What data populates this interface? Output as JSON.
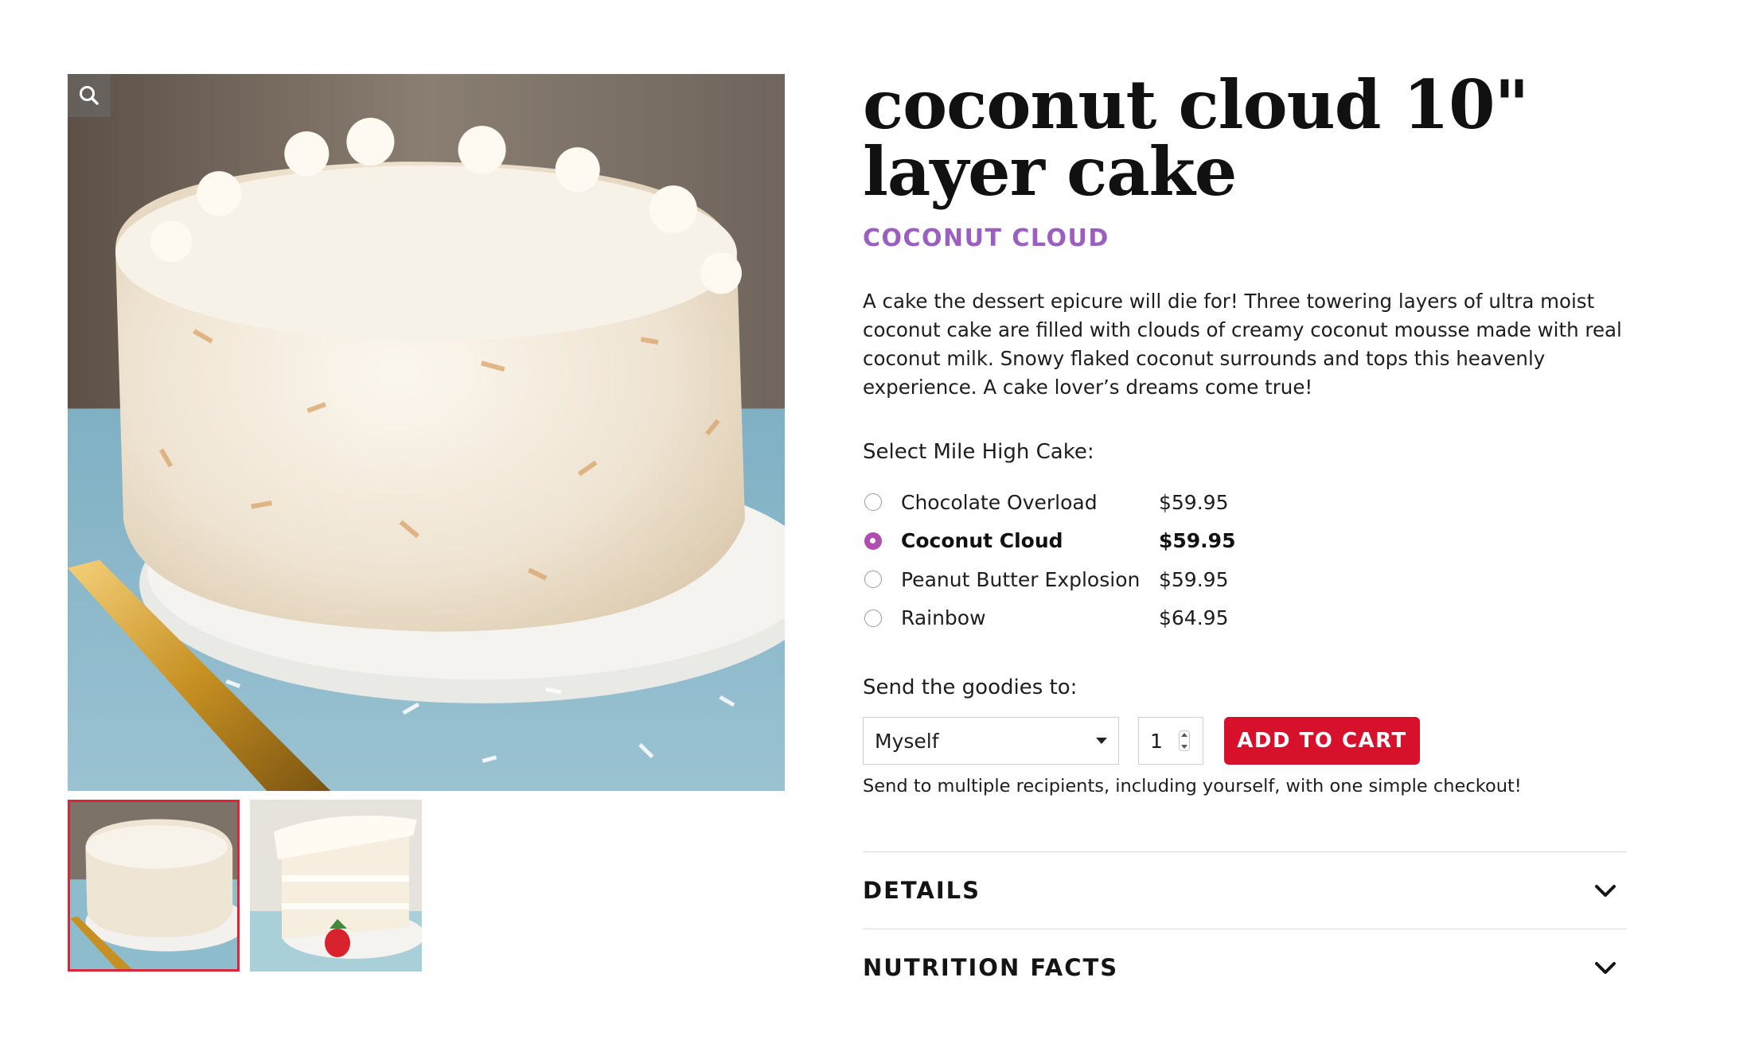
{
  "gallery": {
    "zoom_icon": "search-icon",
    "selected_thumbnail": 1,
    "thumbnail_count": 2
  },
  "product": {
    "title": "coconut cloud 10\" layer cake",
    "brand": "COCONUT CLOUD",
    "description": "A cake the dessert epicure will die for! Three towering layers of ultra moist coconut cake are filled with clouds of creamy coconut mousse made with real coconut milk. Snowy flaked coconut surrounds and tops this heavenly experience. A cake lover’s dreams come true!"
  },
  "variant_picker": {
    "label": "Select Mile High Cake:",
    "options": [
      {
        "name": "Chocolate Overload",
        "price": "$59.95",
        "selected": false
      },
      {
        "name": "Coconut Cloud",
        "price": "$59.95",
        "selected": true
      },
      {
        "name": "Peanut Butter Explosion",
        "price": "$59.95",
        "selected": false
      },
      {
        "name": "Rainbow",
        "price": "$64.95",
        "selected": false
      }
    ]
  },
  "purchase": {
    "send_label": "Send the goodies to:",
    "recipient_value": "Myself",
    "quantity": "1",
    "add_to_cart_label": "ADD TO CART",
    "note": "Send to multiple recipients, including yourself, with one simple checkout!"
  },
  "accordion": [
    {
      "label": "DETAILS",
      "icon": "chevron-down-icon"
    },
    {
      "label": "NUTRITION FACTS",
      "icon": "chevron-down-icon"
    }
  ],
  "colors": {
    "brand_purple": "#9b5fc0",
    "radio_selected": "#b04fae",
    "cta_red": "#d7102c",
    "thumb_border": "#d9263a"
  }
}
